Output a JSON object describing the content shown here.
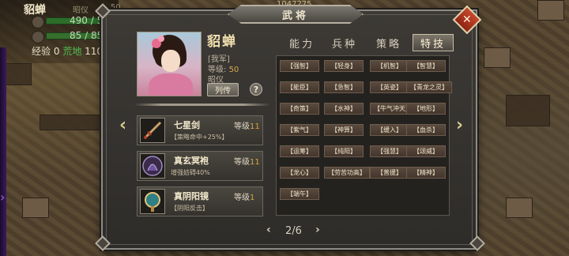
{
  "dialog": {
    "title": "武将",
    "close_icon": "✕"
  },
  "hud": {
    "name": "貂蝉",
    "label1": "昭仪",
    "num1": "50",
    "hp": "490 / 5",
    "troops": "85 / 85",
    "exp_label": "经验",
    "exp_value": "0",
    "land_label": "荒地",
    "land_value": "110",
    "top_counter": "1047275"
  },
  "character": {
    "name": "貂蝉",
    "faction": "[我军]",
    "level_label": "等级:",
    "level_value": "50",
    "title": "昭仪",
    "list_button": "列传",
    "help_button": "?"
  },
  "equipment": [
    {
      "name": "七星剑",
      "level_label": "等级",
      "level": "11",
      "desc": "【策略命中+25%】",
      "icon": "sword-icon"
    },
    {
      "name": "真玄冥袍",
      "level_label": "等级",
      "level": "11",
      "desc": "增强妨碍40%",
      "icon": "robe-icon"
    },
    {
      "name": "真阴阳镜",
      "level_label": "等级",
      "level": "1",
      "desc": "【阴阳反击】",
      "icon": "mirror-icon"
    }
  ],
  "tabs": [
    {
      "label": "能力",
      "active": false
    },
    {
      "label": "兵种",
      "active": false
    },
    {
      "label": "策略",
      "active": false
    },
    {
      "label": "特技",
      "active": true
    }
  ],
  "skills": [
    "【强智】",
    "【轻身】",
    "【机智】",
    "【智慧】",
    "【能臣】",
    "【急智】",
    "【英姿】",
    "【青龙之灵】",
    "【奇策】",
    "【水神】",
    "【牛气冲天】",
    "【地形】",
    "【紫气】",
    "【神算】",
    "【缓入】",
    "【血杀】",
    "【运筹】",
    "【纯阳】",
    "【强慧】",
    "【颂威】",
    "【龙心】",
    "【劳苦功高】",
    "【普援】",
    "【精神】",
    "【端午】"
  ],
  "pagination": {
    "current": "2",
    "total": "6",
    "text": "2/6",
    "prev": "‹",
    "next": "›"
  },
  "nav_arrows": {
    "left": "‹",
    "right": "›"
  }
}
